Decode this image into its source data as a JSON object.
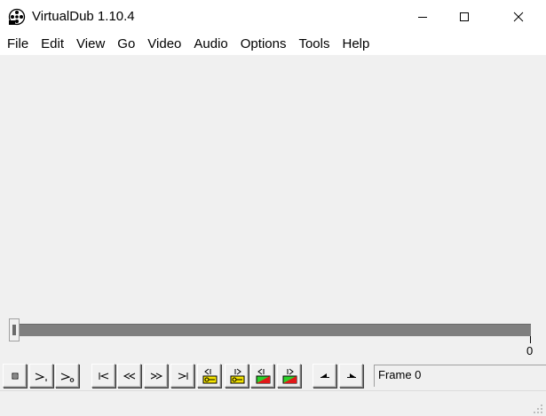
{
  "window": {
    "title": "VirtualDub 1.10.4",
    "app_icon": "virtualdub-film-reel-icon"
  },
  "caption_buttons": {
    "minimize_icon": "minimize-icon",
    "maximize_icon": "maximize-icon",
    "close_icon": "close-icon"
  },
  "menu": {
    "items": [
      {
        "label": "File"
      },
      {
        "label": "Edit"
      },
      {
        "label": "View"
      },
      {
        "label": "Go"
      },
      {
        "label": "Video"
      },
      {
        "label": "Audio"
      },
      {
        "label": "Options"
      },
      {
        "label": "Tools"
      },
      {
        "label": "Help"
      }
    ]
  },
  "position_slider": {
    "current_frame": 0,
    "end_label": "0"
  },
  "toolbar": {
    "buttons": [
      {
        "name": "stop-button",
        "icon": "stop-icon"
      },
      {
        "name": "play-input-button",
        "icon": "play-input-icon"
      },
      {
        "name": "play-output-button",
        "icon": "play-output-icon"
      },
      {
        "name": "go-to-start-button",
        "icon": "go-to-start-icon"
      },
      {
        "name": "previous-frame-button",
        "icon": "previous-frame-icon"
      },
      {
        "name": "next-frame-button",
        "icon": "next-frame-icon"
      },
      {
        "name": "go-to-end-button",
        "icon": "go-to-end-icon"
      },
      {
        "name": "previous-keyframe-button",
        "icon": "previous-keyframe-icon"
      },
      {
        "name": "next-keyframe-button",
        "icon": "next-keyframe-icon"
      },
      {
        "name": "previous-scene-button",
        "icon": "previous-scene-icon"
      },
      {
        "name": "next-scene-button",
        "icon": "next-scene-icon"
      },
      {
        "name": "mark-in-button",
        "icon": "mark-in-icon"
      },
      {
        "name": "mark-out-button",
        "icon": "mark-out-icon"
      }
    ]
  },
  "status": {
    "frame_text": "Frame 0"
  },
  "colors": {
    "window_bg": "#f0f0f0",
    "titlebar_bg": "#ffffff",
    "slider_track": "#7f7f7f",
    "key_yellow": "#f5e400",
    "scene_green": "#2bd12b",
    "scene_red": "#e01818"
  }
}
